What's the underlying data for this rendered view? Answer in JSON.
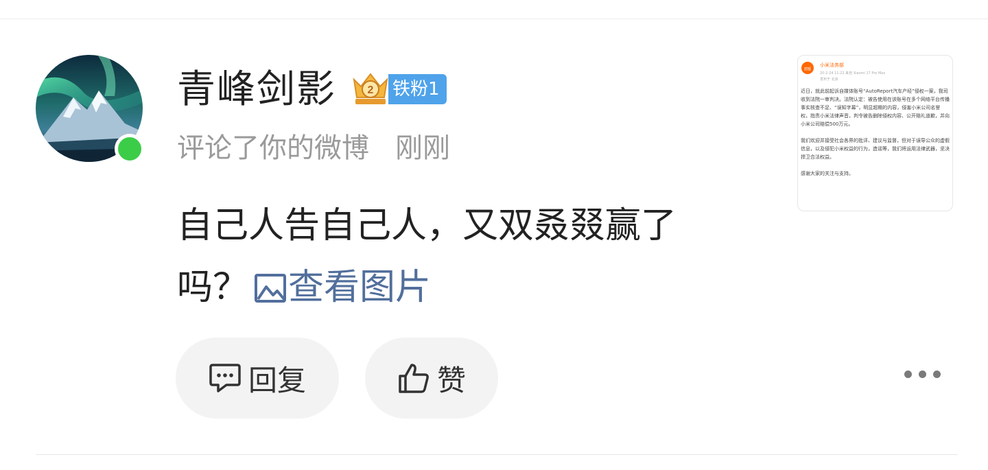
{
  "user": {
    "name": "青峰剑影",
    "fan_level_label": "铁粉1",
    "fan_level_number": "2"
  },
  "notification": {
    "action": "评论了你的微博",
    "time": "刚刚"
  },
  "comment": {
    "text": "自己人告自己人，又双叒叕赢了吗？",
    "view_image_label": "查看图片"
  },
  "thumbnail": {
    "account": "小米法务部",
    "logo": "mi",
    "meta": "20-2-24 11:22  来自 Xiaomi 17 Pro Max",
    "location": "发布于 北京",
    "paragraphs": [
      "近日，就此前起诉自媒体账号“AutoReport汽车产经”侵权一案，我司收到法院一审判决。法院认定：被告使用在该账号在多个网络平台传播事实核查不足、“误知字幕”，明显超期的内容，侵害小米公司名誉权，指责小米法律声音，判令被告删除侵权内容、公开赔礼道歉，并向小米公司赔偿500万元。",
      "我们欢迎并接受社会各界的批评、建议与监督，但对于误导公众的虚假信息，以及侵犯小米权益的行为，造谣等，我们将运用法律武器，坚决捍卫合法权益。",
      "感谢大家的关注与支持。"
    ]
  },
  "actions": {
    "reply": "回复",
    "like": "赞"
  },
  "colors": {
    "online": "#3ccd48",
    "link": "#526f9c",
    "badge": "#4fa3ea",
    "brand_orange": "#ff6700"
  }
}
